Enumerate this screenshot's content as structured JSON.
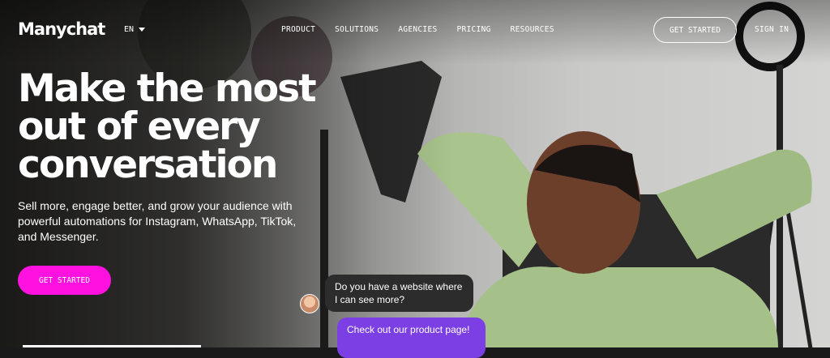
{
  "brand": {
    "logo": "Manychat"
  },
  "header": {
    "lang": "EN",
    "nav": [
      "PRODUCT",
      "SOLUTIONS",
      "AGENCIES",
      "PRICING",
      "RESOURCES"
    ],
    "get_started": "GET STARTED",
    "sign_in": "SIGN IN"
  },
  "hero": {
    "headline": [
      "Make the most",
      "out of every",
      "conversation"
    ],
    "subtitle": "Sell more, engage better, and grow your audience with powerful automations for Instagram, WhatsApp, TikTok, and Messenger.",
    "cta": "GET STARTED"
  },
  "chat": {
    "message_in": "Do you have a website where I can see more?",
    "message_out": "Check out our product page!"
  },
  "colors": {
    "accent": "#ff12e0",
    "chat_purple": "#7b3fe4",
    "chat_dark": "#2c2c2c"
  }
}
